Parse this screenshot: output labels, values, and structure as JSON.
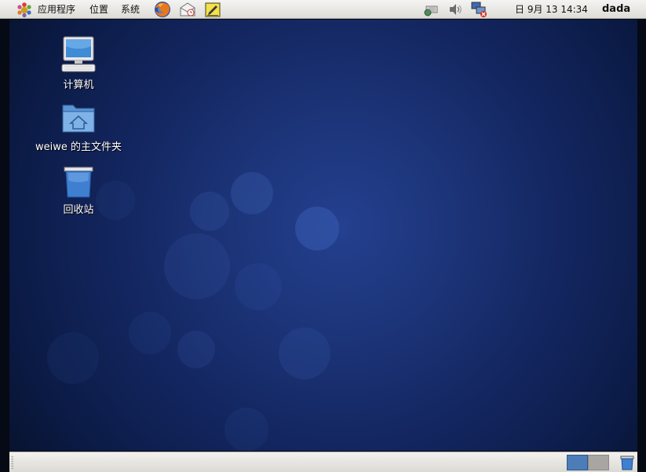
{
  "top_panel": {
    "menus": {
      "applications": "应用程序",
      "places": "位置",
      "system": "系统"
    },
    "clock": "日 9月 13 14:34",
    "user": "dada"
  },
  "desktop": {
    "icons": [
      {
        "label": "计算机"
      },
      {
        "label": "weiwe 的主文件夹"
      },
      {
        "label": "回收站"
      }
    ]
  },
  "colors": {
    "desktop_center": "#24408f",
    "desktop_edge": "#08132f",
    "workspace_active": "#4c7db8",
    "workspace_inactive": "#a8a6a2"
  }
}
